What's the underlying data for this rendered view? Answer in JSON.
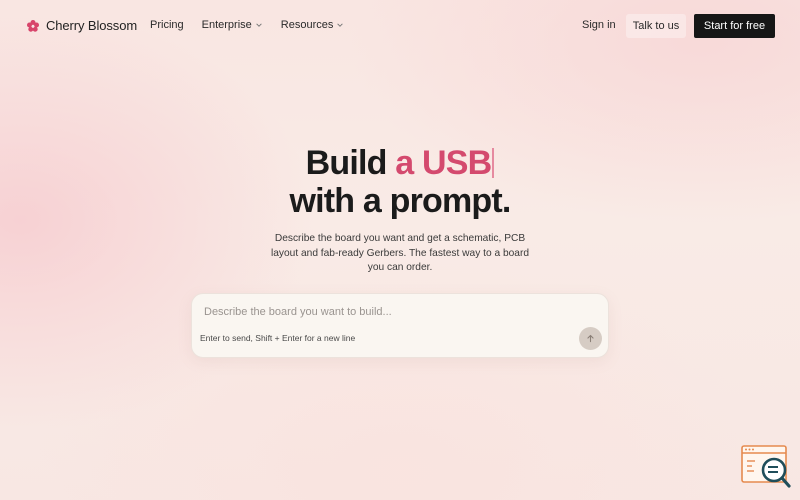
{
  "brand": {
    "name": "Cherry Blossom",
    "icon": "flower-icon",
    "color": "#d8456b"
  },
  "nav": {
    "items": [
      {
        "label": "Pricing",
        "dropdown": false
      },
      {
        "label": "Enterprise",
        "dropdown": true
      },
      {
        "label": "Resources",
        "dropdown": true
      }
    ]
  },
  "header_actions": {
    "sign_in": "Sign in",
    "talk": "Talk to us",
    "start": "Start for free"
  },
  "hero": {
    "title_prefix": "Build ",
    "title_accent": "a USB",
    "title_line2": "with a prompt.",
    "subtitle": "Describe the board you want and get a schematic, PCB layout and fab-ready Gerbers. The fastest way to a board you can order."
  },
  "prompt": {
    "placeholder": "Describe the board you want to build...",
    "value": "",
    "hint": "Enter to send, Shift + Enter for a new line",
    "send_icon": "arrow-up-icon"
  },
  "widget": {
    "icon": "chat-search-icon",
    "color": "#e58a4f"
  },
  "colors": {
    "accent": "#d44a6e",
    "primary_button": "#161616"
  }
}
